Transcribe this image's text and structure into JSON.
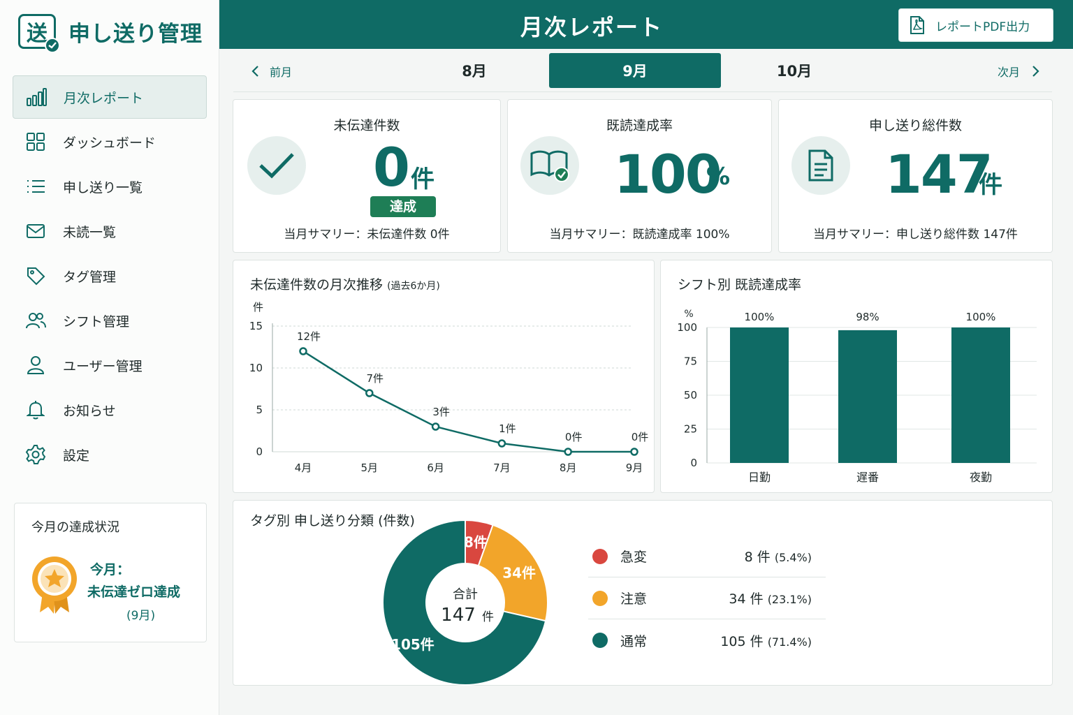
{
  "app": {
    "logo_char": "送",
    "title": "申し送り管理"
  },
  "sidebar": {
    "items": [
      {
        "label": "月次レポート",
        "icon": "bar-chart-icon",
        "active": true
      },
      {
        "label": "ダッシュボード",
        "icon": "grid-icon"
      },
      {
        "label": "申し送り一覧",
        "icon": "list-icon"
      },
      {
        "label": "未読一覧",
        "icon": "mail-icon"
      },
      {
        "label": "タグ管理",
        "icon": "tag-icon"
      },
      {
        "label": "シフト管理",
        "icon": "users-icon"
      },
      {
        "label": "ユーザー管理",
        "icon": "user-icon"
      },
      {
        "label": "お知らせ",
        "icon": "bell-icon"
      },
      {
        "label": "設定",
        "icon": "gear-icon"
      }
    ],
    "achievement": {
      "title": "今月の達成状況",
      "line1": "今月：",
      "line2": "未伝達ゼロ達成",
      "line3": "(9月)"
    }
  },
  "header": {
    "title": "月次レポート",
    "pdf_label": "レポートPDF出力"
  },
  "month_nav": {
    "prev": "前月",
    "next": "次月",
    "tabs": [
      "8月",
      "9月",
      "10月"
    ],
    "active": "9月"
  },
  "kpis": {
    "undelivered": {
      "title": "未伝達件数",
      "value": "0",
      "unit": "件",
      "badge": "達成",
      "footer": "当月サマリー：未伝達件数 0件"
    },
    "read_rate": {
      "title": "既読達成率",
      "value": "100",
      "unit": "%",
      "footer": "当月サマリー：既読達成率 100%"
    },
    "total": {
      "title": "申し送り総件数",
      "value": "147",
      "unit": "件",
      "footer": "当月サマリー：申し送り総件数 147件"
    }
  },
  "colors": {
    "primary": "#0f6b65",
    "red": "#d9473f",
    "orange": "#f2a52a",
    "teal": "#0f6b65",
    "badge_green": "#1e7e56"
  },
  "chart_data": [
    {
      "type": "line",
      "title": "未伝達件数の月次推移",
      "subtitle": "(過去6か月)",
      "ylabel": "件",
      "categories": [
        "4月",
        "5月",
        "6月",
        "7月",
        "8月",
        "9月"
      ],
      "values": [
        12,
        7,
        3,
        1,
        0,
        0
      ],
      "data_labels": [
        "12件",
        "7件",
        "3件",
        "1件",
        "0件",
        "0件"
      ],
      "ylim": [
        0,
        15
      ],
      "yticks": [
        0,
        5,
        10,
        15
      ],
      "grid": true
    },
    {
      "type": "bar",
      "title": "シフト別 既読達成率",
      "ylabel": "%",
      "categories": [
        "日勤",
        "遅番",
        "夜勤"
      ],
      "values": [
        100,
        98,
        100
      ],
      "data_labels": [
        "100%",
        "98%",
        "100%"
      ],
      "ylim": [
        0,
        100
      ],
      "yticks": [
        0,
        25,
        50,
        75,
        100
      ],
      "grid": true
    },
    {
      "type": "pie",
      "title": "タグ別 申し送り分類 (件数)",
      "center_label": "合計",
      "center_value": "147",
      "center_unit": "件",
      "categories": [
        "急変",
        "注意",
        "通常"
      ],
      "values": [
        8,
        34,
        105
      ],
      "slice_labels": [
        "8件",
        "34件",
        "105件"
      ],
      "legend_counts": [
        "8",
        "34",
        "105"
      ],
      "legend_unit": "件",
      "legend_pct": [
        "(5.4%)",
        "(23.1%)",
        "(71.4%)"
      ],
      "colors": [
        "#d9473f",
        "#f2a52a",
        "#0f6b65"
      ]
    }
  ]
}
